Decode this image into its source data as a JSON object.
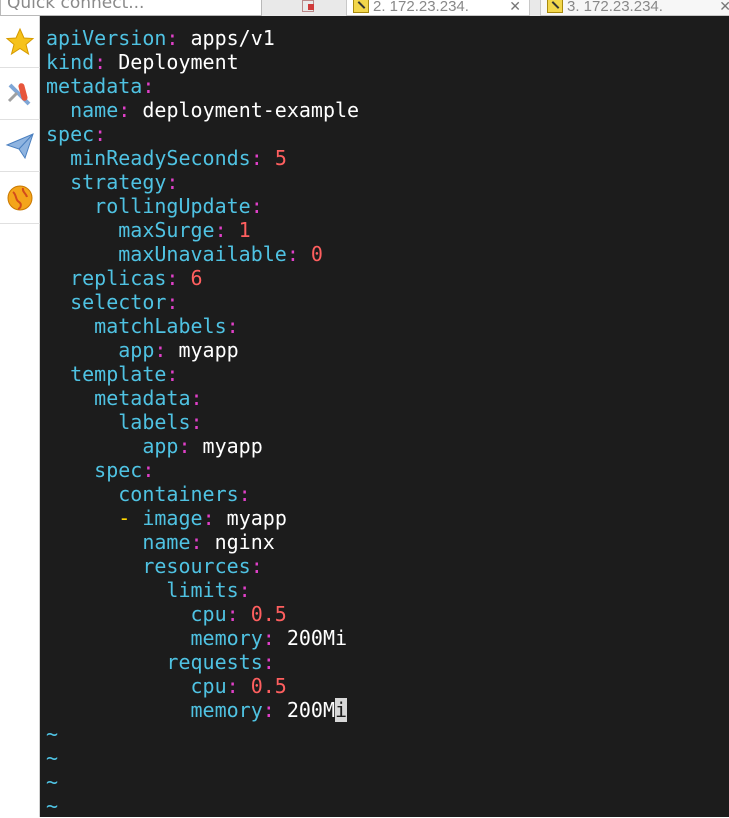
{
  "toolbar": {
    "quick_connect_placeholder": "Quick connect..."
  },
  "tabs": [
    {
      "label": "2. 172.23.234.",
      "active": true
    },
    {
      "label": "3. 172.23.234.",
      "active": false
    }
  ],
  "sidebar_icons": [
    "star-icon",
    "settings-tools-icon",
    "paper-plane-icon",
    "globe-icon"
  ],
  "colors": {
    "key": "#4fc2e2",
    "colon": "#e040c8",
    "number": "#ff5f5f",
    "value": "#ffffff",
    "dash": "#ffd700",
    "terminal_bg": "#1c1c1c"
  },
  "editor": {
    "lines": [
      {
        "indent": "",
        "key": "apiVersion",
        "value": "apps/v1",
        "value_type": "text"
      },
      {
        "indent": "",
        "key": "kind",
        "value": "Deployment",
        "value_type": "text"
      },
      {
        "indent": "",
        "key": "metadata",
        "value": "",
        "value_type": "none"
      },
      {
        "indent": "  ",
        "key": "name",
        "value": "deployment-example",
        "value_type": "text"
      },
      {
        "indent": "",
        "key": "spec",
        "value": "",
        "value_type": "none"
      },
      {
        "indent": "  ",
        "key": "minReadySeconds",
        "value": "5",
        "value_type": "number"
      },
      {
        "indent": "  ",
        "key": "strategy",
        "value": "",
        "value_type": "none"
      },
      {
        "indent": "    ",
        "key": "rollingUpdate",
        "value": "",
        "value_type": "none"
      },
      {
        "indent": "      ",
        "key": "maxSurge",
        "value": "1",
        "value_type": "number"
      },
      {
        "indent": "      ",
        "key": "maxUnavailable",
        "value": "0",
        "value_type": "number"
      },
      {
        "indent": "  ",
        "key": "replicas",
        "value": "6",
        "value_type": "number"
      },
      {
        "indent": "  ",
        "key": "selector",
        "value": "",
        "value_type": "none"
      },
      {
        "indent": "    ",
        "key": "matchLabels",
        "value": "",
        "value_type": "none"
      },
      {
        "indent": "      ",
        "key": "app",
        "value": "myapp",
        "value_type": "text"
      },
      {
        "indent": "  ",
        "key": "template",
        "value": "",
        "value_type": "none"
      },
      {
        "indent": "    ",
        "key": "metadata",
        "value": "",
        "value_type": "none"
      },
      {
        "indent": "      ",
        "key": "labels",
        "value": "",
        "value_type": "none"
      },
      {
        "indent": "        ",
        "key": "app",
        "value": "myapp",
        "value_type": "text"
      },
      {
        "indent": "    ",
        "key": "spec",
        "value": "",
        "value_type": "none"
      },
      {
        "indent": "      ",
        "key": "containers",
        "value": "",
        "value_type": "none"
      },
      {
        "indent": "      ",
        "dash": "- ",
        "key": "image",
        "value": "myapp",
        "value_type": "text"
      },
      {
        "indent": "        ",
        "key": "name",
        "value": "nginx",
        "value_type": "text"
      },
      {
        "indent": "        ",
        "key": "resources",
        "value": "",
        "value_type": "none"
      },
      {
        "indent": "          ",
        "key": "limits",
        "value": "",
        "value_type": "none"
      },
      {
        "indent": "            ",
        "key": "cpu",
        "value": "0.5",
        "value_type": "number"
      },
      {
        "indent": "            ",
        "key": "memory",
        "value": "200Mi",
        "value_type": "text"
      },
      {
        "indent": "          ",
        "key": "requests",
        "value": "",
        "value_type": "none"
      },
      {
        "indent": "            ",
        "key": "cpu",
        "value": "0.5",
        "value_type": "number"
      },
      {
        "indent": "            ",
        "key": "memory",
        "value": "200Mi",
        "value_type": "text",
        "cursor_on_last_char": true
      }
    ],
    "tilde_lines": [
      "~",
      "~",
      "~",
      "~"
    ]
  }
}
